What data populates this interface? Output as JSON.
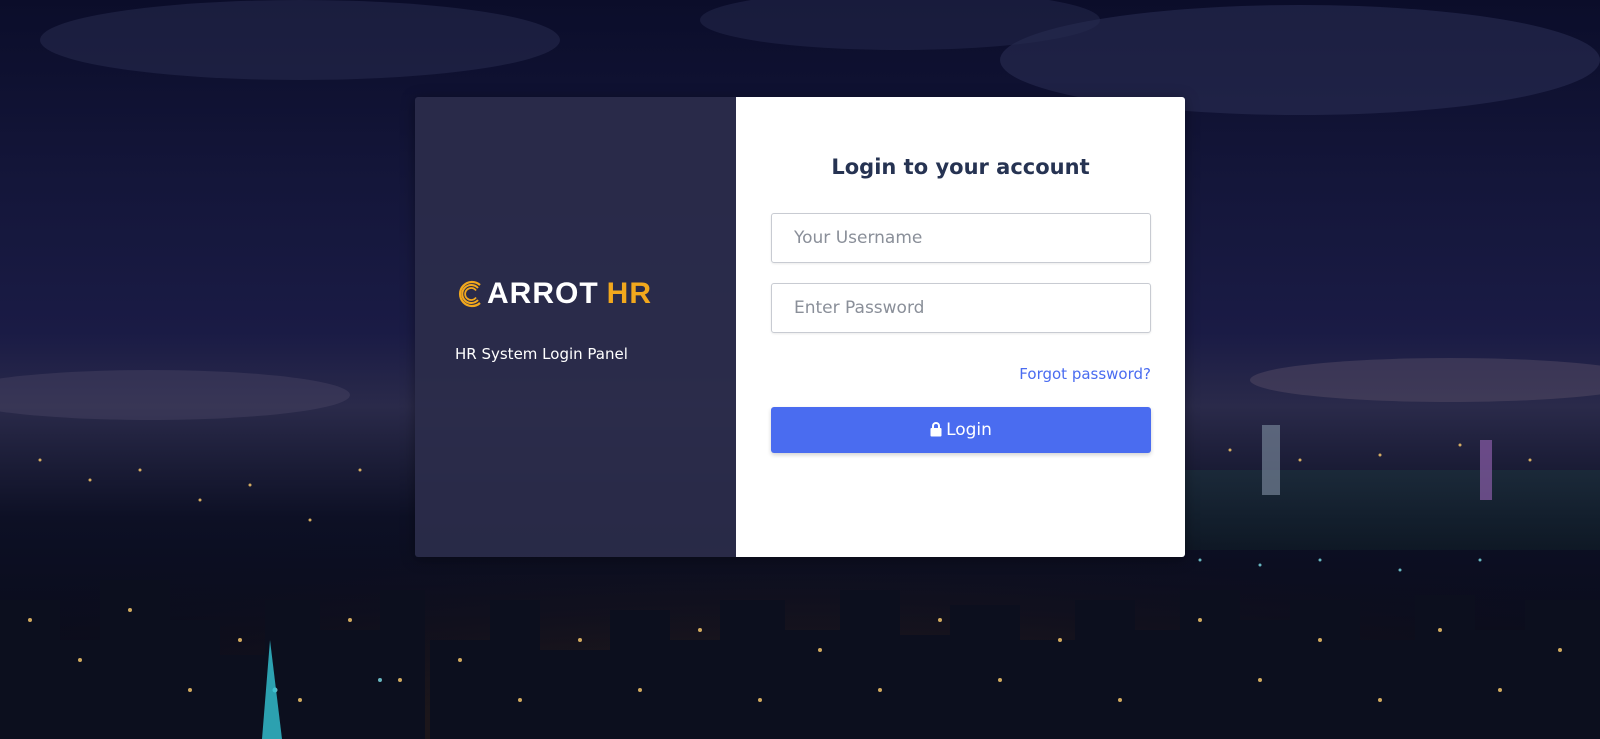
{
  "brand": {
    "name": "ARROT",
    "accent": "HR",
    "logo_icon": "carrot-c-rings-icon",
    "accent_color": "#f2a81d"
  },
  "left_panel": {
    "subtitle": "HR System Login Panel"
  },
  "form": {
    "title": "Login to your account",
    "username_placeholder": "Your Username",
    "password_placeholder": "Enter Password",
    "forgot_label": "Forgot password?",
    "login_label": "Login",
    "login_icon": "lock-icon",
    "primary_color": "#4a6cf0"
  },
  "background": {
    "scene": "city-skyline-night"
  }
}
